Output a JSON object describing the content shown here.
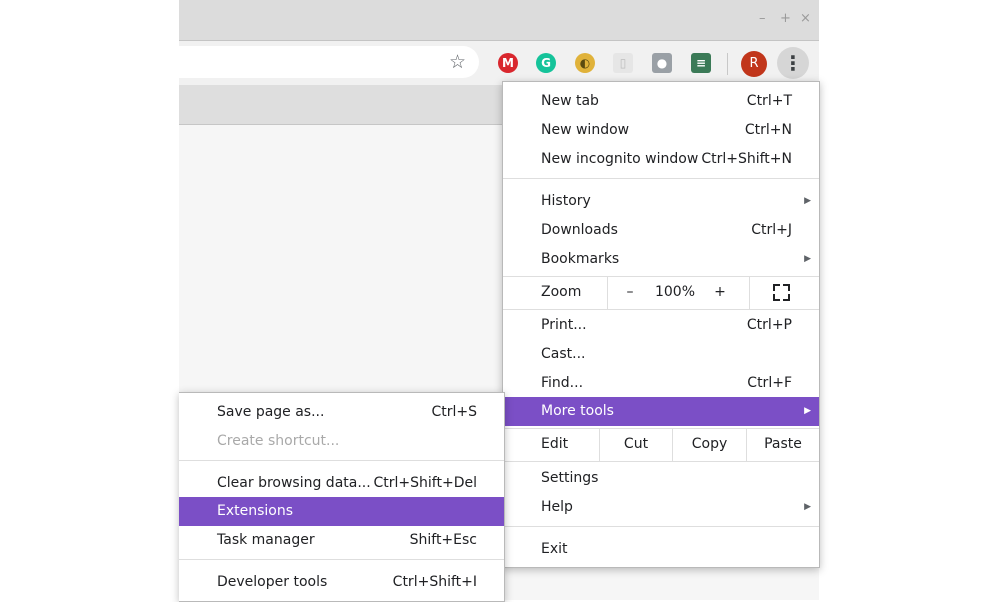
{
  "window_controls": {
    "minimize": "–",
    "maximize": "+",
    "close": "×"
  },
  "toolbar": {
    "star_icon": "☆",
    "extensions": [
      {
        "icon": "mega-icon",
        "glyph": "M",
        "color": "#d9272e"
      },
      {
        "icon": "grammarly-icon",
        "glyph": "G",
        "color": "#15c39a"
      },
      {
        "icon": "chromecast-extension-icon",
        "glyph": "◐",
        "color": "#e0b23a"
      },
      {
        "icon": "keep-icon",
        "glyph": "▯",
        "color": "#e6e6e6"
      },
      {
        "icon": "user-extension-icon",
        "glyph": "●",
        "color": "#9aa0a6"
      },
      {
        "icon": "stack-extension-icon",
        "glyph": "≡",
        "color": "#3b7a57"
      }
    ],
    "avatar_letter": "R",
    "menu_icon": "⋮"
  },
  "main_menu": {
    "new_tab": {
      "label": "New tab",
      "shortcut": "Ctrl+T"
    },
    "new_window": {
      "label": "New window",
      "shortcut": "Ctrl+N"
    },
    "new_incognito": {
      "label": "New incognito window",
      "shortcut": "Ctrl+Shift+N"
    },
    "history": {
      "label": "History"
    },
    "downloads": {
      "label": "Downloads",
      "shortcut": "Ctrl+J"
    },
    "bookmarks": {
      "label": "Bookmarks"
    },
    "zoom": {
      "label": "Zoom",
      "minus": "–",
      "value": "100%",
      "plus": "+"
    },
    "print": {
      "label": "Print...",
      "shortcut": "Ctrl+P"
    },
    "cast": {
      "label": "Cast..."
    },
    "find": {
      "label": "Find...",
      "shortcut": "Ctrl+F"
    },
    "more_tools": {
      "label": "More tools"
    },
    "edit": {
      "label": "Edit",
      "cut": "Cut",
      "copy": "Copy",
      "paste": "Paste"
    },
    "settings": {
      "label": "Settings"
    },
    "help": {
      "label": "Help"
    },
    "exit": {
      "label": "Exit"
    },
    "arrow": "▶"
  },
  "sub_menu": {
    "save_page": {
      "label": "Save page as...",
      "shortcut": "Ctrl+S"
    },
    "create_shortcut": {
      "label": "Create shortcut..."
    },
    "clear_data": {
      "label": "Clear browsing data...",
      "shortcut": "Ctrl+Shift+Del"
    },
    "extensions": {
      "label": "Extensions"
    },
    "task_manager": {
      "label": "Task manager",
      "shortcut": "Shift+Esc"
    },
    "dev_tools": {
      "label": "Developer tools",
      "shortcut": "Ctrl+Shift+I"
    }
  },
  "colors": {
    "selection": "#7b4fc6",
    "avatar": "#c1361b"
  }
}
